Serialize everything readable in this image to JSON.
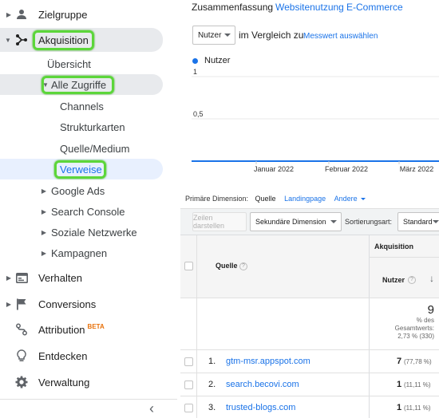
{
  "sidebar": {
    "items": [
      {
        "label": "Zielgruppe",
        "icon": "person-icon"
      },
      {
        "label": "Akquisition",
        "icon": "acquisition-icon"
      },
      {
        "label": "Übersicht"
      },
      {
        "label": "Alle Zugriffe"
      },
      {
        "label": "Channels"
      },
      {
        "label": "Strukturkarten"
      },
      {
        "label": "Quelle/Medium"
      },
      {
        "label": "Verweise"
      },
      {
        "label": "Google Ads"
      },
      {
        "label": "Search Console"
      },
      {
        "label": "Soziale Netzwerke"
      },
      {
        "label": "Kampagnen"
      },
      {
        "label": "Verhalten",
        "icon": "behavior-icon"
      },
      {
        "label": "Conversions",
        "icon": "flag-icon"
      },
      {
        "label": "Attribution",
        "icon": "attribution-icon",
        "badge": "BETA"
      },
      {
        "label": "Entdecken",
        "icon": "lightbulb-icon"
      },
      {
        "label": "Verwaltung",
        "icon": "gear-icon"
      }
    ],
    "collapse_glyph": "‹"
  },
  "tabs": [
    "Zusammenfassung",
    "Websitenutzung",
    "E-Commerce"
  ],
  "metric_select": {
    "value": "Nutzer",
    "compare_text": "im Vergleich zu",
    "choose_link": "Messwert auswählen"
  },
  "chart_data": {
    "type": "line",
    "series": [
      {
        "name": "Nutzer",
        "color": "#1a73e8",
        "values": [
          0,
          0,
          0,
          0,
          0,
          0,
          0,
          0,
          0,
          0,
          0,
          0
        ]
      }
    ],
    "y_ticks": [
      "1",
      "0,5"
    ],
    "x_ticks": [
      "Januar 2022",
      "Februar 2022",
      "März 2022"
    ],
    "ylim": [
      0,
      1
    ]
  },
  "dimension_bar": {
    "label": "Primäre Dimension:",
    "active": "Quelle",
    "options": [
      "Landingpage",
      "Andere"
    ]
  },
  "controls": {
    "plot_rows": "Zeilen darstellen",
    "secondary": "Sekundäre Dimension",
    "sort_label": "Sortierungsart:",
    "sort_value": "Standard"
  },
  "table": {
    "group_header": "Akquisition",
    "col_source": "Quelle",
    "col_users": "Nutzer",
    "total_value": "9",
    "total_line1": "% des",
    "total_line2": "Gesamtwerts:",
    "total_line3": "2,73 % (330)",
    "rows": [
      {
        "index": "1.",
        "source": "gtm-msr.appspot.com",
        "users": "7",
        "pct": "(77,78 %)"
      },
      {
        "index": "2.",
        "source": "search.becovi.com",
        "users": "1",
        "pct": "(11,11 %)"
      },
      {
        "index": "3.",
        "source": "trusted-blogs.com",
        "users": "1",
        "pct": "(11,11 %)"
      }
    ]
  }
}
